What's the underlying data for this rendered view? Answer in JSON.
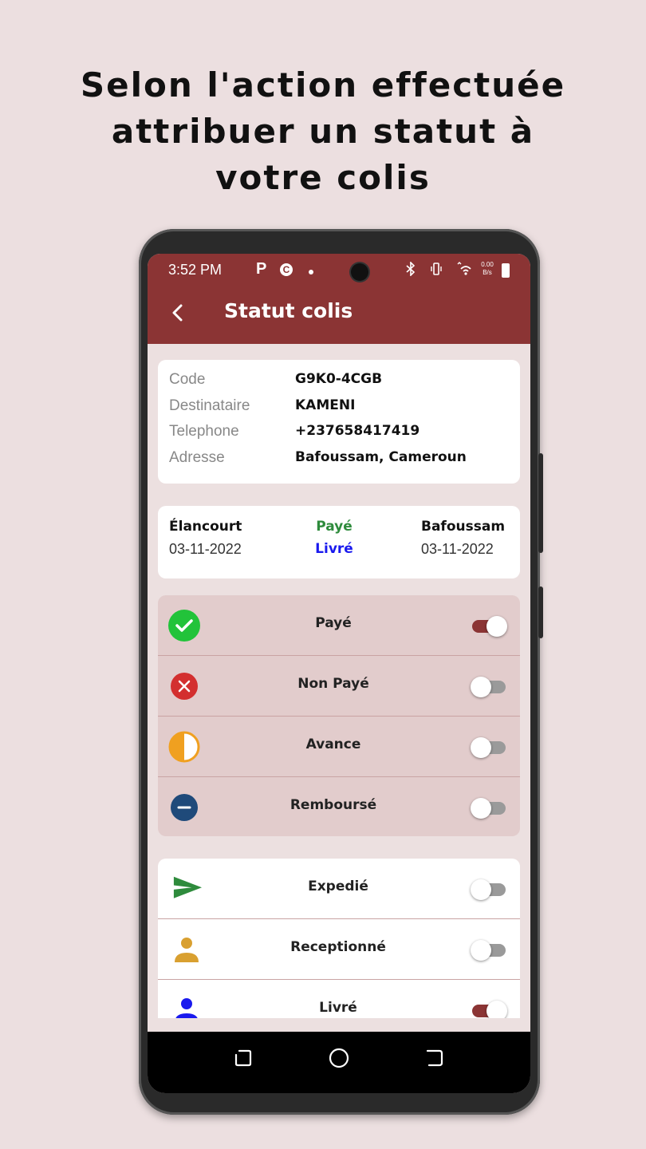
{
  "headline": {
    "line1": "Selon l'action effectuée",
    "line2": "attribuer un statut à",
    "line3": "votre colis"
  },
  "status_bar": {
    "time": "3:52 PM",
    "p_icon": "P",
    "speed": "0.00 B/s"
  },
  "appbar": {
    "back_icon": "chevron-left-icon",
    "title": "Statut colis"
  },
  "parcel_info": {
    "rows": [
      {
        "label": "Code",
        "value": "G9K0-4CGB"
      },
      {
        "label": "Destinataire",
        "value": "KAMENI"
      },
      {
        "label": "Telephone",
        "value": "+237658417419"
      },
      {
        "label": "Adresse",
        "value": "Bafoussam, Cameroun"
      }
    ]
  },
  "route": {
    "from_place": "Élancourt",
    "from_date": "03-11-2022",
    "status_paid": "Payé",
    "status_delivered": "Livré",
    "to_place": "Bafoussam",
    "to_date": "03-11-2022"
  },
  "payment_statuses": [
    {
      "label": "Payé",
      "icon": "check-circle-icon",
      "on": true
    },
    {
      "label": "Non Payé",
      "icon": "x-circle-icon",
      "on": false
    },
    {
      "label": "Avance",
      "icon": "half-circle-icon",
      "on": false
    },
    {
      "label": "Remboursé",
      "icon": "minus-circle-icon",
      "on": false
    }
  ],
  "shipping_statuses": [
    {
      "label": "Expedié",
      "icon": "send-icon",
      "on": false
    },
    {
      "label": "Receptionné",
      "icon": "person-icon",
      "on": false
    },
    {
      "label": "Livré",
      "icon": "person-icon",
      "on": true
    }
  ],
  "colors": {
    "brand": "#8b3434",
    "paid_text": "#2e8b3c",
    "delivered_text": "#1a1aee",
    "check_green": "#22c33a",
    "cancel_red": "#d32f2f",
    "advance_orange": "#f0a020",
    "refund_navy": "#1f4a7a",
    "send_green": "#2e8b3c",
    "receptionne_gold": "#d9a030",
    "livre_blue": "#1a1aee"
  }
}
